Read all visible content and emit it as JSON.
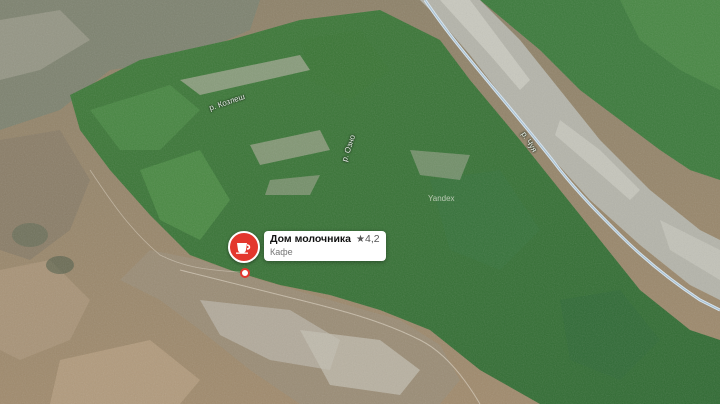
{
  "map": {
    "labels": {
      "river_kozlesh": "р. Козлеш",
      "river_ozho": "р. Озно",
      "river_right": "р. Чуя"
    },
    "watermark": "Yandex"
  },
  "poi": {
    "name": "Дом молочника",
    "rating": "4,2",
    "category": "Кафе",
    "icon": "cup-icon",
    "accent_color": "#e3372d"
  },
  "colors": {
    "forest": "#3f7a3a",
    "steppe": "#8b7c63",
    "river": "#d9e7f2",
    "rock": "#b8b7b0"
  }
}
